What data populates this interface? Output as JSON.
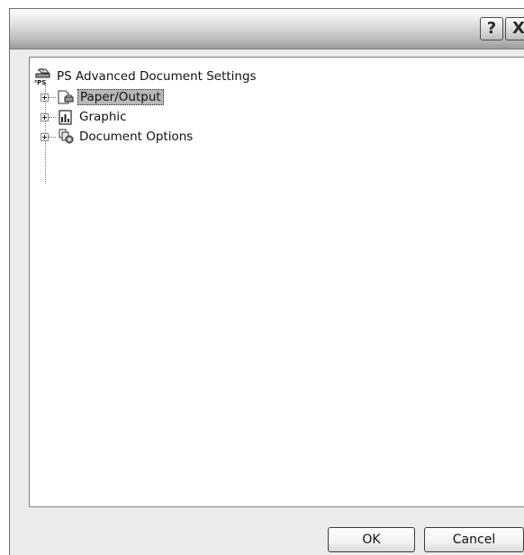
{
  "titlebar": {
    "help_label": "?",
    "close_label": "X"
  },
  "tree": {
    "root_label": "PS Advanced Document Settings",
    "items": [
      {
        "label": "Paper/Output",
        "icon": "printer-paper-icon",
        "selected": true
      },
      {
        "label": "Graphic",
        "icon": "bar-chart-icon",
        "selected": false
      },
      {
        "label": "Document Options",
        "icon": "document-options-icon",
        "selected": false
      }
    ]
  },
  "buttons": {
    "ok_label": "OK",
    "cancel_label": "Cancel"
  }
}
